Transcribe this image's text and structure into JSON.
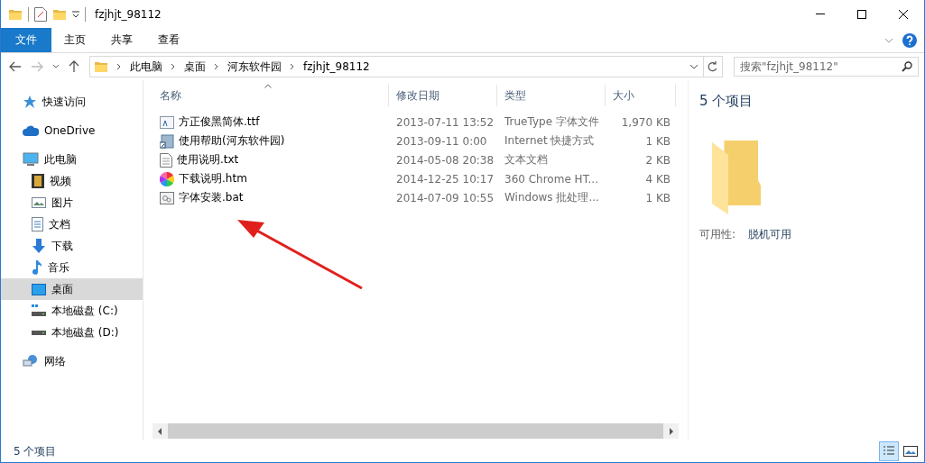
{
  "window": {
    "title": "fzjhjt_98112"
  },
  "ribbon_tabs": [
    {
      "label": "文件",
      "kind": "file",
      "selected": false
    },
    {
      "label": "主页",
      "kind": "tab",
      "selected": false
    },
    {
      "label": "共享",
      "kind": "tab",
      "selected": false
    },
    {
      "label": "查看",
      "kind": "tab",
      "selected": false
    }
  ],
  "address_bar": {
    "path": [
      "此电脑",
      "桌面",
      "河东软件园",
      "fzjhjt_98112"
    ]
  },
  "search": {
    "placeholder": "搜索\"fzjhjt_98112\""
  },
  "sidebar": {
    "items": [
      {
        "label": "快速访问",
        "selected": false
      },
      {
        "label": "OneDrive",
        "selected": false
      },
      {
        "label": "此电脑",
        "selected": false,
        "children": [
          {
            "label": "视频",
            "selected": false
          },
          {
            "label": "图片",
            "selected": false
          },
          {
            "label": "文档",
            "selected": false
          },
          {
            "label": "下载",
            "selected": false
          },
          {
            "label": "音乐",
            "selected": false
          },
          {
            "label": "桌面",
            "selected": true
          },
          {
            "label": "本地磁盘 (C:)",
            "selected": false
          },
          {
            "label": "本地磁盘 (D:)",
            "selected": false
          }
        ]
      },
      {
        "label": "网络",
        "selected": false
      }
    ]
  },
  "table": {
    "columns": [
      "名称",
      "修改日期",
      "类型",
      "大小"
    ],
    "rows": [
      {
        "name": "方正俊黑简体.ttf",
        "date": "2013-07-11 13:52",
        "type": "TrueType 字体文件",
        "size": "1,970 KB"
      },
      {
        "name": "使用帮助(河东软件园)",
        "date": "2013-09-11 0:00",
        "type": "Internet 快捷方式",
        "size": "1 KB"
      },
      {
        "name": "使用说明.txt",
        "date": "2014-05-08 20:38",
        "type": "文本文档",
        "size": "2 KB"
      },
      {
        "name": "下载说明.htm",
        "date": "2014-12-25 10:17",
        "type": "360 Chrome HT...",
        "size": "4 KB"
      },
      {
        "name": "字体安装.bat",
        "date": "2014-07-09 10:55",
        "type": "Windows 批处理...",
        "size": "1 KB"
      }
    ]
  },
  "details_pane": {
    "title": "5 个项目",
    "label": "可用性:",
    "value": "脱机可用"
  },
  "status_bar": {
    "text": "5 个项目",
    "views": [
      {
        "kind": "details",
        "selected": true
      },
      {
        "kind": "large-icons",
        "selected": false
      }
    ]
  }
}
